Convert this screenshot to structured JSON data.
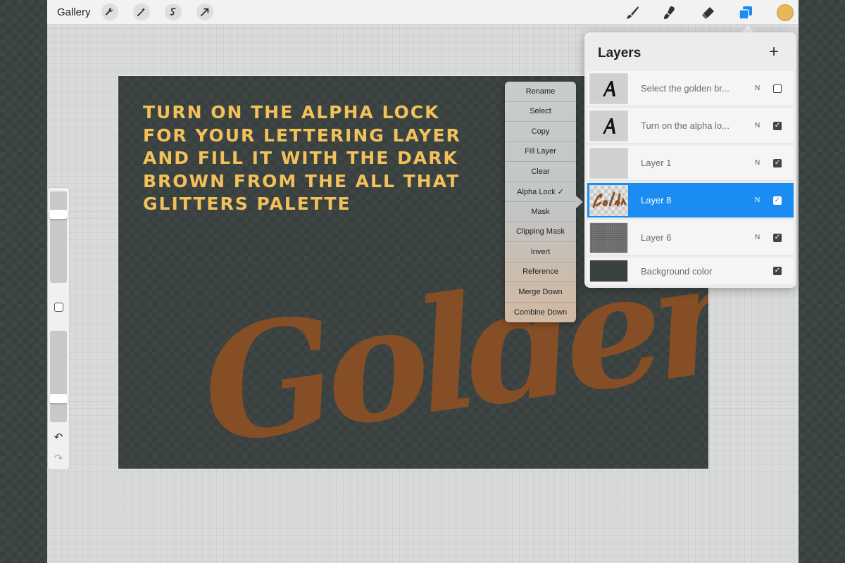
{
  "toolbar": {
    "gallery_label": "Gallery",
    "left_tools": [
      "wrench-icon",
      "magic-wand-icon",
      "selection-icon",
      "transform-arrow-icon"
    ],
    "right_tools": [
      "brush-icon",
      "smudge-icon",
      "eraser-icon",
      "layers-icon"
    ],
    "current_color": "#e8b75a"
  },
  "canvas": {
    "background_color": "#39413f",
    "instruction_lines": [
      "Turn on the alpha lock",
      "for your lettering layer",
      "and fill it with the dark",
      "brown from the All That",
      "Glitters palette"
    ],
    "lettering_text": "Golden",
    "text_color": "#f2c15a",
    "lettering_color": "#8e5023"
  },
  "context_menu": {
    "items": [
      {
        "label": "Rename"
      },
      {
        "label": "Select"
      },
      {
        "label": "Copy"
      },
      {
        "label": "Fill Layer"
      },
      {
        "label": "Clear"
      },
      {
        "label": "Alpha Lock ✓"
      },
      {
        "label": "Mask"
      },
      {
        "label": "Clipping Mask"
      },
      {
        "label": "Invert"
      },
      {
        "label": "Reference"
      },
      {
        "label": "Merge Down"
      },
      {
        "label": "Combine Down"
      }
    ]
  },
  "layers_panel": {
    "title": "Layers",
    "add_label": "+",
    "layers": [
      {
        "name": "Select the golden br...",
        "mode": "N",
        "visible": false,
        "thumb": "text-A",
        "selected": false
      },
      {
        "name": "Turn on the alpha lo...",
        "mode": "N",
        "visible": true,
        "thumb": "text-A",
        "selected": false
      },
      {
        "name": "Layer 1",
        "mode": "N",
        "visible": true,
        "thumb": "blank",
        "selected": false
      },
      {
        "name": "Layer 8",
        "mode": "N",
        "visible": true,
        "thumb": "golden",
        "selected": true
      },
      {
        "name": "Layer 6",
        "mode": "N",
        "visible": true,
        "thumb": "texture",
        "selected": false
      },
      {
        "name": "Background color",
        "mode": "",
        "visible": true,
        "thumb": "dark",
        "selected": false
      }
    ],
    "selected_color": "#1a8cf2"
  },
  "sidebar": {
    "brush_size_level": 0.78,
    "opacity_level": 0.23
  }
}
